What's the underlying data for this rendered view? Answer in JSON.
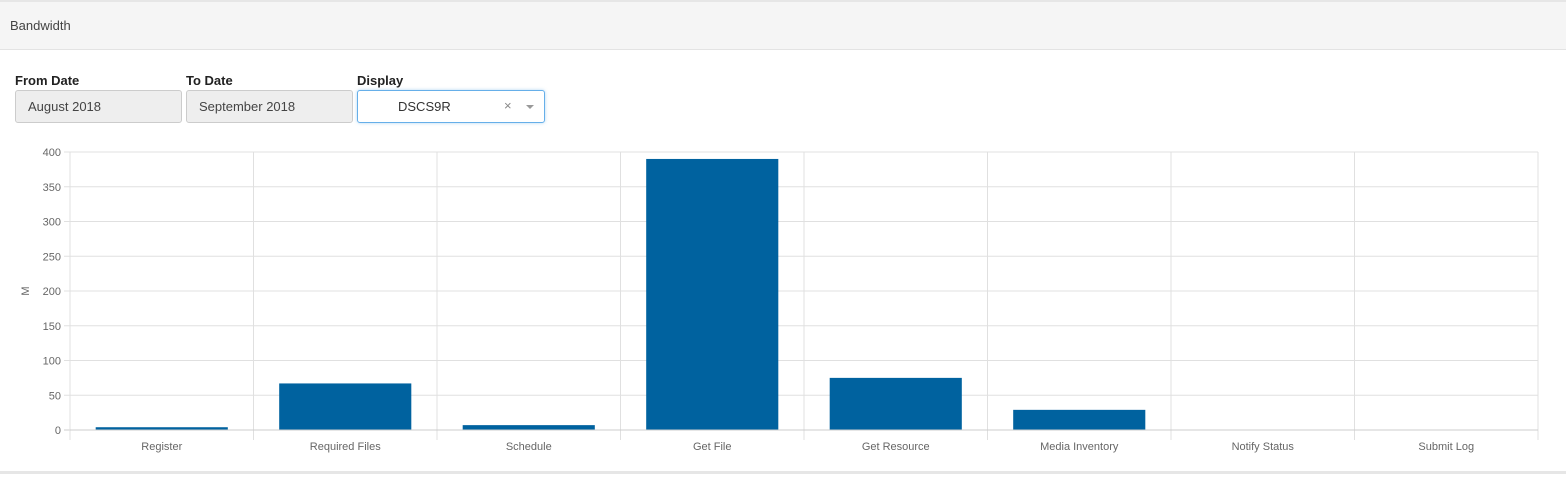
{
  "panel": {
    "title": "Bandwidth"
  },
  "filters": {
    "from_label": "From Date",
    "from_value": "August 2018",
    "to_label": "To Date",
    "to_value": "September 2018",
    "display_label": "Display",
    "display_value": "DSCS9R",
    "clear_glyph": "×",
    "arrow_icon": "caret-down-icon"
  },
  "colors": {
    "bar": "#00629f",
    "grid": "#e0e0e0",
    "axis": "#cccccc",
    "select_border": "#66afe9"
  },
  "chart_data": {
    "type": "bar",
    "title": "",
    "xlabel": "",
    "ylabel": "M",
    "categories": [
      "Register",
      "Required Files",
      "Schedule",
      "Get File",
      "Get Resource",
      "Media Inventory",
      "Notify Status",
      "Submit Log"
    ],
    "values": [
      4,
      67,
      7,
      390,
      75,
      29,
      0,
      0
    ],
    "ylim": [
      0,
      400
    ],
    "yticks": [
      0,
      50,
      100,
      150,
      200,
      250,
      300,
      350,
      400
    ],
    "grid": true,
    "legend": "none"
  }
}
